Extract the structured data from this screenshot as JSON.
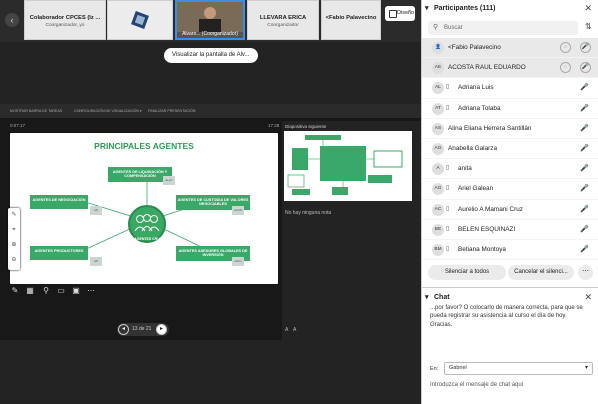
{
  "topstrip": {
    "tiles": [
      {
        "name": "Colaborador CPCES (Iz ...",
        "role": "Coorganizador, yo"
      },
      {
        "name": "Alvaro...",
        "role": "(Coorganizador)"
      },
      {
        "name": "LLEVARA ERICA",
        "role": "Coorganizador"
      },
      {
        "name": "<Fabio Palavecino",
        "role": ""
      }
    ],
    "layout_label": "Diseño"
  },
  "share_label": "Visualizar la pantalla de Alv...",
  "slide": {
    "title": "PRINCIPALES AGENTES",
    "center": "AGENTES CRU",
    "agents": [
      "AGENTES DE LIQUIDACIÓN Y COMPENSACIÓN",
      "AGENTES DE NEGOCIACIÓN",
      "AGENTES DE CUSTODIA DE VALORES NEGOCIABLES",
      "AGENTES PRODUCTORES",
      "AGENTES ASESORES GLOBALES DE INVERSIÓN"
    ],
    "tags": [
      "ALyC",
      "AN",
      "ACVN",
      "AP",
      "AAGI"
    ]
  },
  "presenter": {
    "toolbar": [
      "MOSTRAR BARRA DE TAREAS",
      "CONFIGURACIÓN DE VISUALIZACIÓN ▾",
      "FINALIZAR PRESENTACIÓN"
    ],
    "elapsed": "0:07:17",
    "clock": "17:28",
    "next_label": "Diapositiva siguiente",
    "notes": "No hay ninguna nota",
    "pager": "13 de 21"
  },
  "participants": {
    "header": "Participantes (111)",
    "search_placeholder": "Buscar",
    "items": [
      {
        "initials": "",
        "name": "<Fabio Palavecino"
      },
      {
        "initials": "AE",
        "name": "ACOSTA RAUL EDUARDO"
      },
      {
        "initials": "AL",
        "name": "Adriana Luis"
      },
      {
        "initials": "AT",
        "name": "Adriana Tolaba"
      },
      {
        "initials": "AS",
        "name": "Alina Eliana Herrera Santillán"
      },
      {
        "initials": "AG",
        "name": "Anabella Galarza"
      },
      {
        "initials": "A",
        "name": "anita"
      },
      {
        "initials": "AG",
        "name": "Ariel Galean"
      },
      {
        "initials": "AC",
        "name": "Aurelio A Mamani Cruz"
      },
      {
        "initials": "BE",
        "name": "BELEN ESQUINAZI"
      },
      {
        "initials": "BM",
        "name": "Betiana Montoya"
      }
    ],
    "mute_all": "Silenciar a todos",
    "cancel_mute": "Cancelar el silenci..."
  },
  "chat": {
    "header": "Chat",
    "message": "...por favor? O colocarlo de manera correcta, para que se pueda registrar su asistencia al curso el día de hoy. Gracias.",
    "to_label": "En:",
    "to_value": "Gabriel",
    "input_placeholder": "Introduzca el mensaje de chat aquí"
  }
}
